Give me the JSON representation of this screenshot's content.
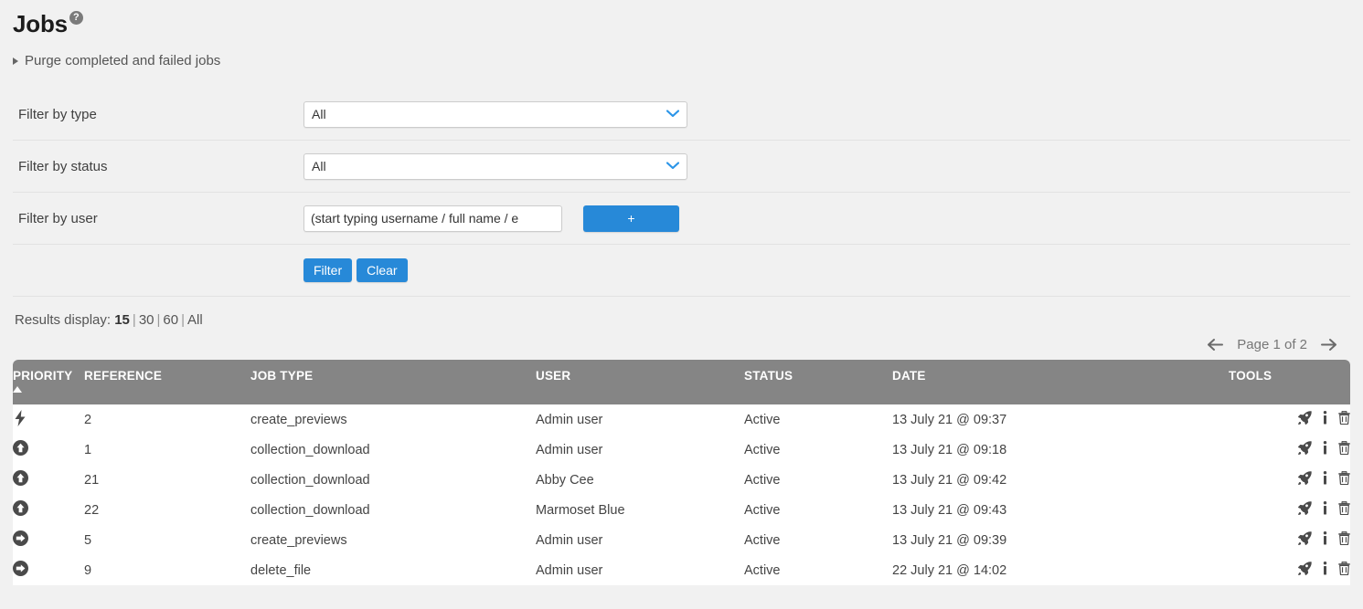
{
  "page": {
    "title": "Jobs",
    "help_icon": "question-mark-icon",
    "purge_label": "Purge completed and failed jobs"
  },
  "filters": {
    "type": {
      "label": "Filter by type",
      "value": "All",
      "options": [
        "All"
      ]
    },
    "status": {
      "label": "Filter by status",
      "value": "All",
      "options": [
        "All"
      ]
    },
    "user": {
      "label": "Filter by user",
      "value": "",
      "placeholder": "(start typing username / full name / e",
      "add_button": "+"
    },
    "filter_button": "Filter",
    "clear_button": "Clear"
  },
  "results": {
    "label": "Results display:",
    "options": [
      "15",
      "30",
      "60",
      "All"
    ],
    "selected": "15",
    "separator": "|"
  },
  "pagination": {
    "prev_icon": "arrow-left-icon",
    "next_icon": "arrow-right-icon",
    "text": "Page 1 of 2"
  },
  "table": {
    "columns": [
      "PRIORITY",
      "REFERENCE",
      "JOB TYPE",
      "USER",
      "STATUS",
      "DATE",
      "TOOLS"
    ],
    "sort_column": "PRIORITY",
    "sort_direction": "asc",
    "tools_icons": [
      "rocket-icon",
      "info-icon",
      "trash-icon"
    ],
    "rows": [
      {
        "priority_icon": "lightning-bolt-icon",
        "reference": "2",
        "job_type": "create_previews",
        "user": "Admin user",
        "status": "Active",
        "date": "13 July 21 @ 09:37"
      },
      {
        "priority_icon": "arrow-up-circle-icon",
        "reference": "1",
        "job_type": "collection_download",
        "user": "Admin user",
        "status": "Active",
        "date": "13 July 21 @ 09:18"
      },
      {
        "priority_icon": "arrow-up-circle-icon",
        "reference": "21",
        "job_type": "collection_download",
        "user": "Abby Cee",
        "status": "Active",
        "date": "13 July 21 @ 09:42"
      },
      {
        "priority_icon": "arrow-up-circle-icon",
        "reference": "22",
        "job_type": "collection_download",
        "user": "Marmoset Blue",
        "status": "Active",
        "date": "13 July 21 @ 09:43"
      },
      {
        "priority_icon": "arrow-right-circle-icon",
        "reference": "5",
        "job_type": "create_previews",
        "user": "Admin user",
        "status": "Active",
        "date": "13 July 21 @ 09:39"
      },
      {
        "priority_icon": "arrow-right-circle-icon",
        "reference": "9",
        "job_type": "delete_file",
        "user": "Admin user",
        "status": "Active",
        "date": "22 July 21 @ 14:02"
      }
    ]
  },
  "colors": {
    "accent": "#2789d8",
    "page_background": "#f1f1f1",
    "table_header": "#858585",
    "row_background": "#ffffff",
    "text": "#444444"
  }
}
